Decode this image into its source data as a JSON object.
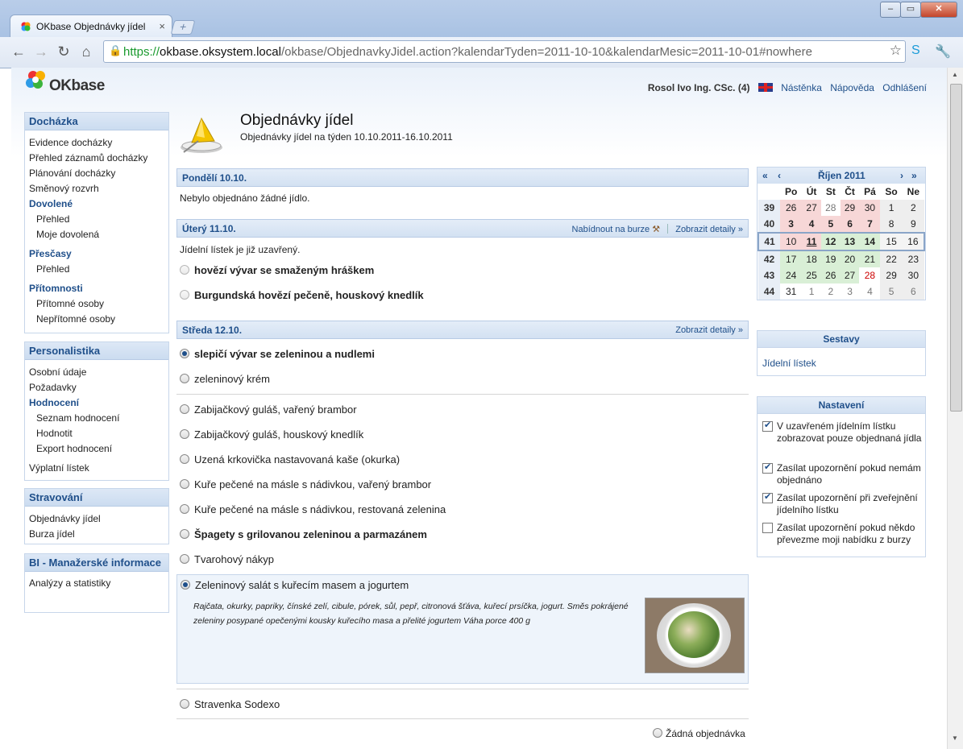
{
  "browser": {
    "tab_title": "OKbase Objednávky jídel",
    "url_https": "https://",
    "url_host": "okbase.oksystem.local",
    "url_path": "/okbase/ObjednavkyJidel.action?kalendarTyden=2011-10-10&kalendarMesic=2011-10-01#nowhere"
  },
  "header": {
    "brand": "OKbase",
    "user": "Rosol Ivo Ing. CSc. (4)",
    "links": [
      "Nástěnka",
      "Nápověda",
      "Odhlášení"
    ]
  },
  "sidebar": {
    "dochazka": {
      "title": "Docházka",
      "items": [
        "Evidence docházky",
        "Přehled záznamů docházky",
        "Plánování docházky",
        "Směnový rozvrh"
      ],
      "dovolene": "Dovolené",
      "dovolene_items": [
        "Přehled",
        "Moje dovolená"
      ],
      "prescasy": "Přesčasy",
      "prescasy_items": [
        "Přehled"
      ],
      "pritomnosti": "Přítomnosti",
      "pritomnosti_items": [
        "Přítomné osoby",
        "Nepřítomné osoby"
      ]
    },
    "personalistika": {
      "title": "Personalistika",
      "items": [
        "Osobní údaje",
        "Požadavky"
      ],
      "hodnoceni": "Hodnocení",
      "hodnoceni_items": [
        "Seznam hodnocení",
        "Hodnotit",
        "Export hodnocení"
      ],
      "vyplatni": "Výplatní lístek"
    },
    "stravovani": {
      "title": "Stravování",
      "items": [
        "Objednávky jídel",
        "Burza jídel"
      ]
    },
    "bi": {
      "title": "BI - Manažerské informace",
      "items": [
        "Analýzy a statistiky"
      ]
    }
  },
  "main": {
    "title": "Objednávky jídel",
    "subtitle": "Objednávky jídel na týden 10.10.2011-16.10.2011",
    "monday": {
      "label": "Pondělí 10.10.",
      "note": "Nebylo objednáno žádné jídlo."
    },
    "tuesday": {
      "label": "Úterý 11.10.",
      "offer": "Nabídnout na burze",
      "details": "Zobrazit detaily",
      "note": "Jídelní lístek je již uzavřený.",
      "meals": [
        "hovězí vývar se smaženým hráškem",
        "Burgundská hovězí pečeně, houskový knedlík"
      ]
    },
    "wednesday": {
      "label": "Středa 12.10.",
      "details": "Zobrazit detaily",
      "soups": [
        "slepičí vývar se zeleninou a nudlemi",
        "zeleninový krém"
      ],
      "meals": [
        "Zabijačkový guláš, vařený brambor",
        "Zabijačkový guláš, houskový knedlík",
        "Uzená krkovička nastavovaná kaše (okurka)",
        "Kuře pečené na másle s nádivkou, vařený brambor",
        "Kuře pečené na másle s nádivkou, restovaná zelenina",
        "Špagety s grilovanou zeleninou a parmazánem",
        "Tvarohový nákyp",
        "Zeleninový salát s kuřecím masem a jogurtem"
      ],
      "salad_description": "Rajčata, okurky, papriky, čínské zelí, cibule, pórek, sůl, pepř, citronová šťáva, kuřecí prsíčka, jogurt. Směs pokrájené zeleniny posypané opečenými kousky kuřecího masa a přelité jogurtem Váha porce 400 g",
      "extra": "Stravenka Sodexo",
      "none": "Žádná objednávka"
    }
  },
  "calendar": {
    "prev_year": "«",
    "prev": "‹",
    "month": "Říjen 2011",
    "next": "›",
    "next_year": "»",
    "days": [
      "Po",
      "Út",
      "St",
      "Čt",
      "Pá",
      "So",
      "Ne"
    ],
    "weeks": [
      {
        "wk": "39",
        "d": [
          "26",
          "27",
          "28",
          "29",
          "30",
          "1",
          "2"
        ]
      },
      {
        "wk": "40",
        "d": [
          "3",
          "4",
          "5",
          "6",
          "7",
          "8",
          "9"
        ]
      },
      {
        "wk": "41",
        "d": [
          "10",
          "11",
          "12",
          "13",
          "14",
          "15",
          "16"
        ]
      },
      {
        "wk": "42",
        "d": [
          "17",
          "18",
          "19",
          "20",
          "21",
          "22",
          "23"
        ]
      },
      {
        "wk": "43",
        "d": [
          "24",
          "25",
          "26",
          "27",
          "28",
          "29",
          "30"
        ]
      },
      {
        "wk": "44",
        "d": [
          "31",
          "1",
          "2",
          "3",
          "4",
          "5",
          "6"
        ]
      }
    ]
  },
  "sestavy": {
    "title": "Sestavy",
    "item": "Jídelní lístek"
  },
  "nastaveni": {
    "title": "Nastavení",
    "options": [
      {
        "label": "V uzavřeném jídelním lístku zobrazovat pouze objednaná jídla",
        "checked": true
      },
      {
        "label": "Zasílat upozornění pokud nemám objednáno",
        "checked": true
      },
      {
        "label": "Zasílat upozornění při zveřejnění jídelního lístku",
        "checked": true
      },
      {
        "label": "Zasílat upozornění pokud někdo převezme moji nabídku z burzy",
        "checked": false
      }
    ]
  }
}
